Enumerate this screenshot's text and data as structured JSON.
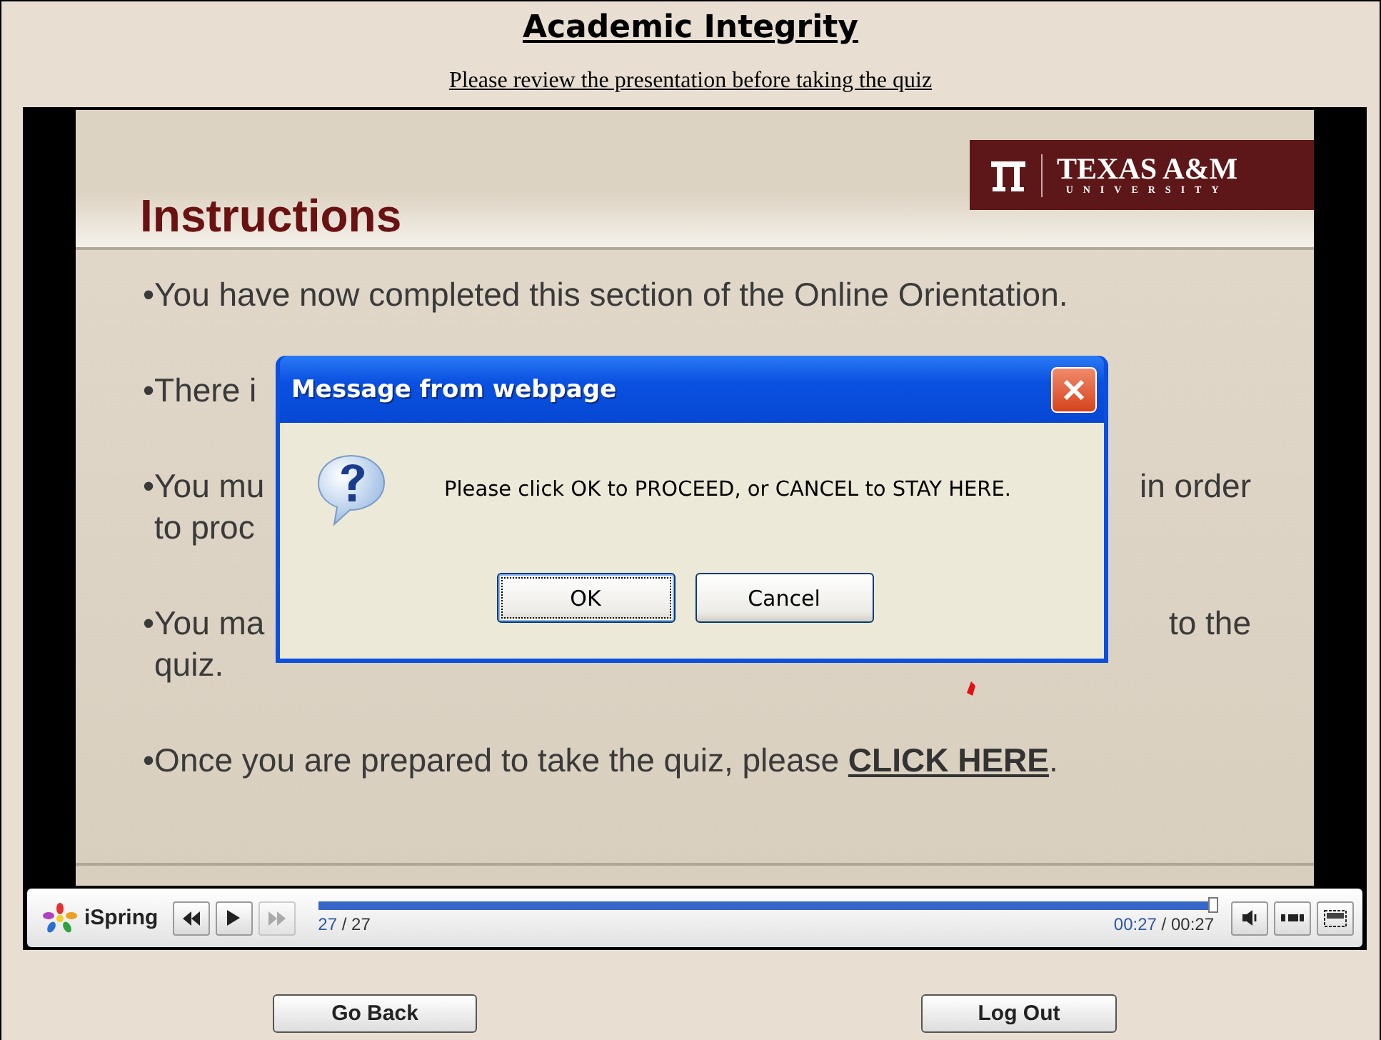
{
  "page": {
    "title": "Academic Integrity",
    "subtitle": "Please review the presentation before taking the quiz"
  },
  "slide": {
    "heading": "Instructions",
    "logo": {
      "name": "TEXAS A&M",
      "sub": "UNIVERSITY"
    },
    "bullets": [
      {
        "lines": [
          {
            "left": "•You have now completed this section of the Online Orientation."
          }
        ]
      },
      {
        "lines": [
          {
            "left": "•There i"
          }
        ]
      },
      {
        "lines": [
          {
            "left": "•You mu",
            "right": "in order"
          },
          {
            "left": "to proc"
          }
        ]
      },
      {
        "lines": [
          {
            "left": "•You ma",
            "right": "to the"
          },
          {
            "left": "quiz."
          }
        ]
      },
      {
        "lines": [
          {
            "left": "•Once you are prepared to take the quiz, please ",
            "link": "CLICK HERE",
            "after": "."
          }
        ]
      }
    ]
  },
  "player": {
    "brand": "iSpring",
    "buttons": [
      {
        "kind": "rewind",
        "disabled": false
      },
      {
        "kind": "play",
        "disabled": false
      },
      {
        "kind": "forward",
        "disabled": true
      }
    ],
    "progress": {
      "level": 1
    },
    "slide_counter": {
      "current": "27",
      "total": "/ 27"
    },
    "time": {
      "elapsed": "00:27",
      "total": "/ 00:27"
    },
    "tools": [
      {
        "kind": "volume"
      },
      {
        "kind": "captions"
      },
      {
        "kind": "fullscreen"
      }
    ]
  },
  "dialog": {
    "title": "Message from webpage",
    "message": "Please click OK to PROCEED, or CANCEL to STAY HERE.",
    "buttons": [
      {
        "label": "OK",
        "selected": true
      },
      {
        "label": "Cancel",
        "selected": false
      }
    ]
  },
  "footer": {
    "buttons": [
      "Go Back",
      "Log Out"
    ]
  }
}
